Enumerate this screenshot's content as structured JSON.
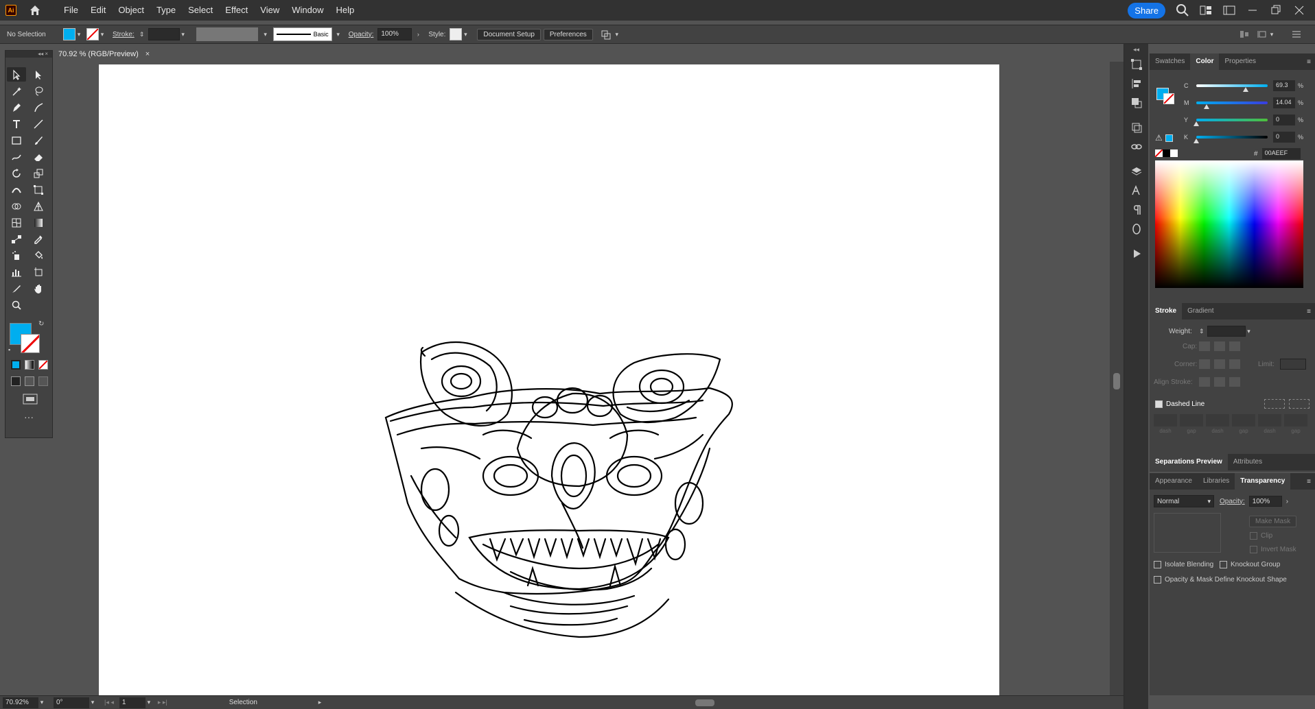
{
  "app": {
    "logo": "Ai"
  },
  "menu": [
    "File",
    "Edit",
    "Object",
    "Type",
    "Select",
    "Effect",
    "View",
    "Window",
    "Help"
  ],
  "share_label": "Share",
  "control": {
    "selection": "No Selection",
    "stroke_label": "Stroke:",
    "brush_label": "Basic",
    "opacity_label": "Opacity:",
    "opacity_value": "100%",
    "style_label": "Style:",
    "doc_setup": "Document Setup",
    "preferences": "Preferences",
    "fill_color": "#00AEEF"
  },
  "document": {
    "tab_title": "70.92 % (RGB/Preview)"
  },
  "status": {
    "zoom": "70.92%",
    "rotation": "0°",
    "artboard": "1",
    "tool": "Selection"
  },
  "color_panel": {
    "tabs": [
      "Swatches",
      "Color",
      "Properties"
    ],
    "active_tab": "Color",
    "channels": [
      {
        "label": "C",
        "value": "69.3",
        "level": 69.3
      },
      {
        "label": "M",
        "value": "14.04",
        "level": 14.04
      },
      {
        "label": "Y",
        "value": "0",
        "level": 0
      },
      {
        "label": "K",
        "value": "0",
        "level": 0
      }
    ],
    "pct_sign": "%",
    "hex_label": "#",
    "hex": "00AEEF"
  },
  "stroke_panel": {
    "tabs": [
      "Stroke",
      "Gradient"
    ],
    "weight_label": "Weight:",
    "cap_label": "Cap:",
    "corner_label": "Corner:",
    "limit_label": "Limit:",
    "align_label": "Align Stroke:",
    "dashed_label": "Dashed Line",
    "dash_labels": [
      "dash",
      "gap",
      "dash",
      "gap",
      "dash",
      "gap"
    ]
  },
  "separations_tabs": [
    "Separations Preview",
    "Attributes"
  ],
  "transparency_panel": {
    "tabs": [
      "Appearance",
      "Libraries",
      "Transparency"
    ],
    "blend_mode": "Normal",
    "opacity_label": "Opacity:",
    "opacity_value": "100%",
    "make_mask": "Make Mask",
    "clip": "Clip",
    "invert_mask": "Invert Mask",
    "isolate": "Isolate Blending",
    "knockout": "Knockout Group",
    "define_knockout": "Opacity & Mask Define Knockout Shape"
  }
}
